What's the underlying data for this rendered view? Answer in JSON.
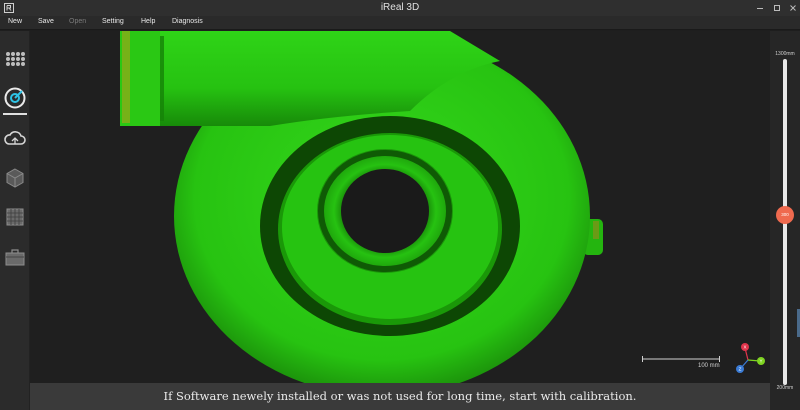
{
  "window": {
    "title": "iReal 3D",
    "logo_icon": "app-logo-icon",
    "controls": [
      "minimize-icon",
      "maximize-icon",
      "close-icon"
    ]
  },
  "menu": {
    "new": "New",
    "save": "Save",
    "open": "Open",
    "setting": "Setting",
    "help": "Help",
    "diagnosis": "Diagnosis"
  },
  "toolbar": {
    "tools": [
      "grid-dots-icon",
      "scan-target-icon",
      "cloud-upload-icon",
      "cube-icon",
      "mesh-grid-icon",
      "toolbox-icon"
    ],
    "active_tool": "scan-target-icon"
  },
  "viewport": {
    "scale_label": "100 mm",
    "axes": {
      "x": "X",
      "y": "Y",
      "z": "Z"
    },
    "axis_colors": {
      "x": "#e0344b",
      "y": "#7ed321",
      "z": "#3a7bd5"
    },
    "model_color": "#25c70f"
  },
  "status": {
    "message": "If Software newely installed or was not used for long time, start with calibration."
  },
  "distance": {
    "max_label": "1300mm",
    "min_label": "200mm",
    "current_label": "300",
    "level": 0.52,
    "handle_color": "#ef6a4f"
  }
}
